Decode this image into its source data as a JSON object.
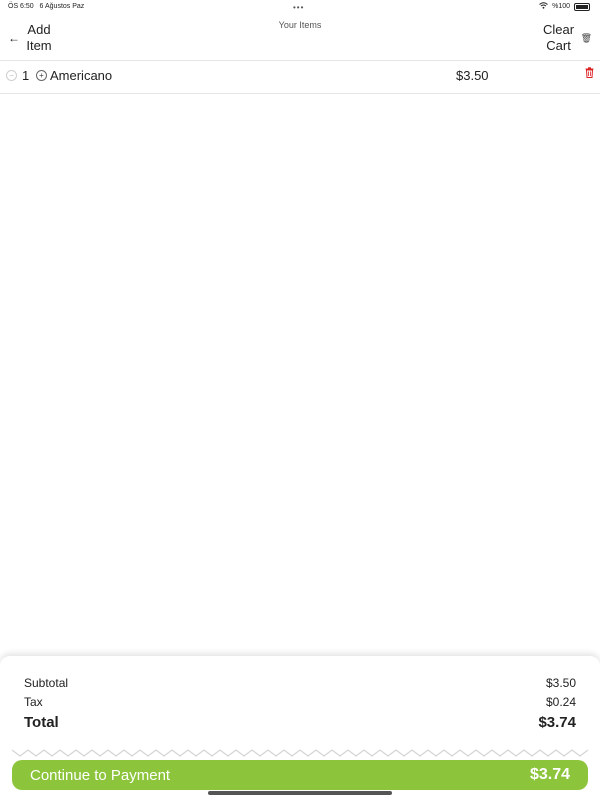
{
  "status_bar": {
    "time": "ÖS 6:50",
    "date": "6 Ağustos Paz",
    "battery": "%100"
  },
  "nav": {
    "back_label": "Add Item",
    "title": "Your Items",
    "clear_label": "Clear Cart"
  },
  "cart": {
    "items": [
      {
        "quantity": "1",
        "name": "Americano",
        "price": "$3.50"
      }
    ]
  },
  "summary": {
    "subtotal_label": "Subtotal",
    "subtotal_value": "$3.50",
    "tax_label": "Tax",
    "tax_value": "$0.24",
    "total_label": "Total",
    "total_value": "$3.74"
  },
  "payment": {
    "label": "Continue to Payment",
    "amount": "$3.74"
  },
  "colors": {
    "accent": "#8cc43c",
    "delete": "#dd2222"
  }
}
